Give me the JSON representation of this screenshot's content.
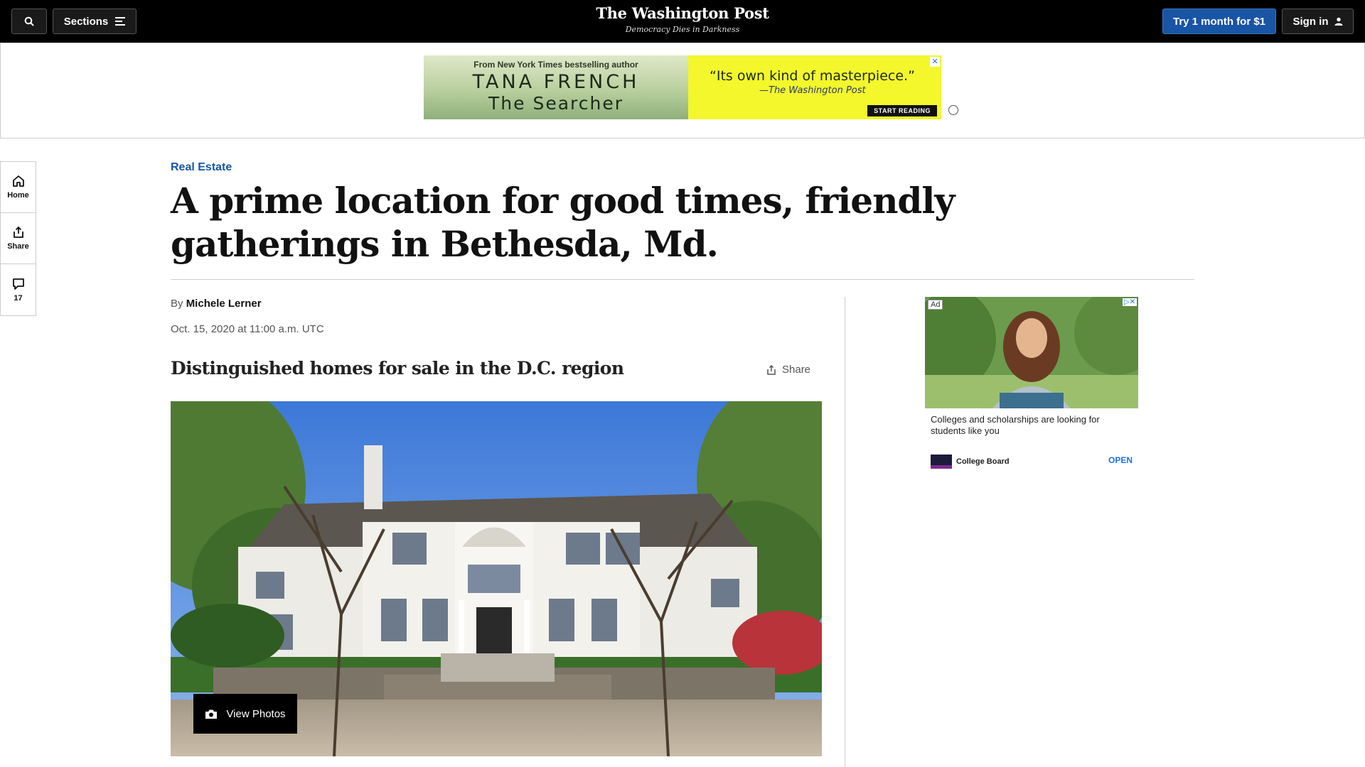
{
  "topnav": {
    "sections_label": "Sections",
    "logo": "The Washington Post",
    "tagline": "Democracy Dies in Darkness",
    "trial_label": "Try 1 month for $1",
    "signin_label": "Sign in"
  },
  "banner_ad": {
    "from_text": "From New York Times bestselling author",
    "author": "TANA FRENCH",
    "book": "The Searcher",
    "quote": "“Its own kind of masterpiece.”",
    "attribution": "—The Washington Post",
    "cta": "START READING",
    "close": "✕"
  },
  "rail": {
    "home": "Home",
    "share": "Share",
    "comments": "17"
  },
  "article": {
    "kicker": "Real Estate",
    "headline": "A prime location for good times, friendly gatherings in Bethesda, Md.",
    "by": "By",
    "author": "Michele Lerner",
    "date": "Oct. 15, 2020 at 11:00 a.m. UTC",
    "gallery_title": "Distinguished homes for sale in the D.C. region",
    "share_label": "Share",
    "view_photos": "View Photos"
  },
  "side_ad": {
    "badge": "Ad",
    "adchoice": "▷✕",
    "text": "Colleges and scholarships are looking for students like you",
    "brand": "College Board",
    "cta": "OPEN"
  }
}
